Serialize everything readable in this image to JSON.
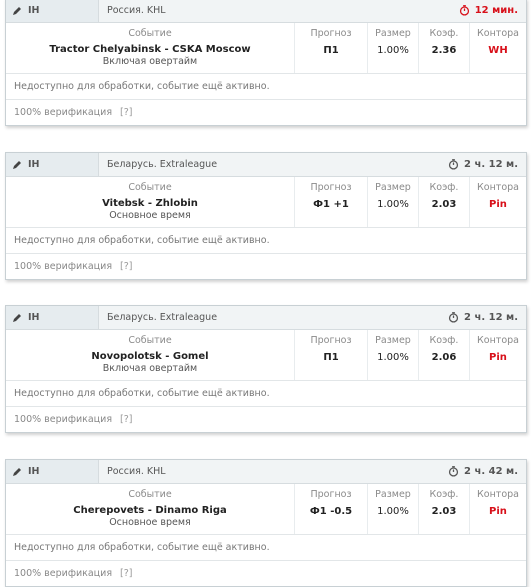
{
  "labels": {
    "event": "Событие",
    "prediction": "Прогноз",
    "size": "Размер",
    "coef": "Коэф.",
    "bookmaker": "Контора",
    "unavailable": "Недоступно для обработки, событие ещё активно.",
    "verification": "100% верификация",
    "verification_help": "[?]"
  },
  "icons": {
    "sport": "pencil-icon",
    "timer": "stopwatch-icon"
  },
  "colors": {
    "urgent": "#d8101a",
    "bookmaker": "#d8101a"
  },
  "cards": [
    {
      "sport": "IH",
      "league": "Россия. KHL",
      "time": "12 мин.",
      "urgent": true,
      "event": "Tractor Chelyabinsk - CSKA Moscow",
      "event_note": "Включая овертайм",
      "prediction": "П1",
      "size": "1.00%",
      "coef": "2.36",
      "bookmaker": "WH"
    },
    {
      "sport": "IH",
      "league": "Беларусь. Extraleague",
      "time": "2 ч. 12 м.",
      "urgent": false,
      "event": "Vitebsk - Zhlobin",
      "event_note": "Основное время",
      "prediction": "Ф1 +1",
      "size": "1.00%",
      "coef": "2.03",
      "bookmaker": "Pin"
    },
    {
      "sport": "IH",
      "league": "Беларусь. Extraleague",
      "time": "2 ч. 12 м.",
      "urgent": false,
      "event": "Novopolotsk - Gomel",
      "event_note": "Включая овертайм",
      "prediction": "П1",
      "size": "1.00%",
      "coef": "2.06",
      "bookmaker": "Pin"
    },
    {
      "sport": "IH",
      "league": "Россия. KHL",
      "time": "2 ч. 42 м.",
      "urgent": false,
      "event": "Cherepovets - Dinamo Riga",
      "event_note": "Основное время",
      "prediction": "Ф1 -0.5",
      "size": "1.00%",
      "coef": "2.03",
      "bookmaker": "Pin"
    }
  ]
}
